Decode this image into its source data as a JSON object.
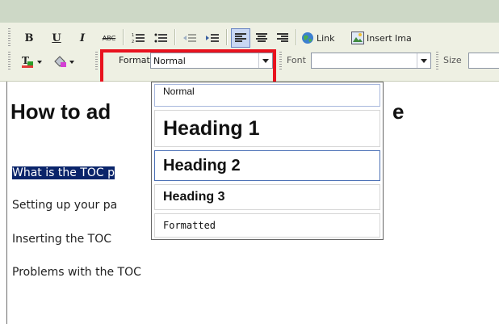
{
  "toolbar": {
    "row1": {
      "bold_label": "B",
      "underline_label": "U",
      "italic_label": "I",
      "strike_label": "ABC",
      "link_label": "Link",
      "insert_image_label": "Insert Ima"
    },
    "row2": {
      "format_label": "Format",
      "format_value": "Normal",
      "font_label": "Font",
      "font_value": "",
      "size_label": "Size",
      "size_value": ""
    }
  },
  "editor": {
    "title": "How to ad",
    "title_suffix": "e",
    "paragraphs": [
      "What is the TOC p",
      "Setting up your pa",
      "Inserting the TOC",
      "Problems with the TOC"
    ]
  },
  "format_dropdown": {
    "options": [
      "Normal",
      "Heading 1",
      "Heading 2",
      "Heading 3",
      "Formatted"
    ],
    "highlighted": "Heading 2"
  },
  "colors": {
    "highlight_box": "#e8121e",
    "selection": "#0a246a",
    "toolbar_bg": "#eef0e3",
    "active_button": "#c9d7f3"
  }
}
